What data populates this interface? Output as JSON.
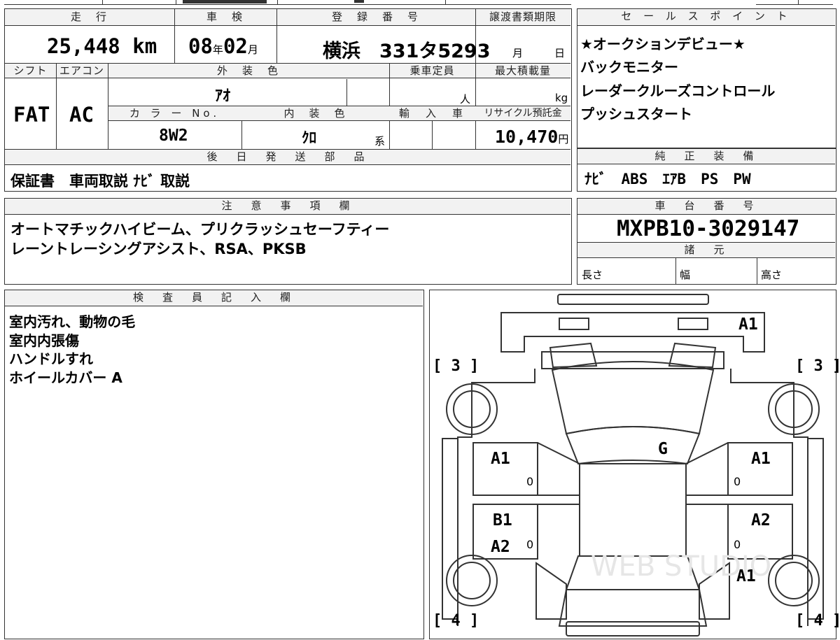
{
  "vehicle": {
    "mileage_header": "走　行",
    "mileage_value": "25,448",
    "mileage_unit": "km",
    "inspection_header": "車　検",
    "inspection_year": "08",
    "inspection_year_unit": "年",
    "inspection_month": "02",
    "inspection_month_unit": "月",
    "registration_header": "登　録　番　号",
    "registration_value": "横浜　331タ5293",
    "transfer_header": "譲渡書類期限",
    "transfer_month_unit": "月",
    "transfer_day_unit": "日",
    "shift_header": "シフト",
    "shift_value": "FAT",
    "ac_header": "エアコン",
    "ac_value": "AC",
    "exterior_color_header": "外　装　色",
    "exterior_color_value": "ｱｵ",
    "capacity_header": "乗車定員",
    "capacity_unit": "人",
    "max_load_header": "最大積載量",
    "max_load_unit": "kg",
    "color_no_header": "カ ラ ー No.",
    "color_no_value": "8W2",
    "interior_color_header": "内　装　色",
    "interior_color_value": "ｸﾛ",
    "interior_color_suffix": "系",
    "import_header": "輸　入　車",
    "recycle_header": "リサイクル預託金",
    "recycle_value": "10,470",
    "recycle_unit": "円",
    "later_parts_header": "後　日　発　送　部　品",
    "later_parts_value": "保証書　車両取説 ﾅﾋﾞ 取説"
  },
  "sales_points": {
    "header": "セ ー ル ス ポ イ ン ト",
    "items": [
      "★オークションデビュー★",
      "バックモニター",
      "レーダークルーズコントロール",
      "プッシュスタート"
    ]
  },
  "genuine_equipment": {
    "header": "純　正　装　備",
    "value": "ﾅﾋﾞ　ABS　ｴｱB　PS　PW"
  },
  "notes": {
    "header": "注　意　事　項　欄",
    "lines": [
      "オートマチックハイビーム、プリクラッシュセーフティー",
      "レーントレーシングアシスト、RSA、PKSB"
    ]
  },
  "chassis": {
    "header": "車　台　番　号",
    "value": "MXPB10-3029147",
    "specs_header": "諸　元",
    "length_label": "長さ",
    "width_label": "幅",
    "height_label": "高さ"
  },
  "inspector": {
    "header": "検　査　員　記　入　欄",
    "lines": [
      "室内汚れ、動物の毛",
      "室内内張傷",
      "ハンドルすれ",
      "ホイールカバー A"
    ]
  },
  "diagram": {
    "marks": {
      "front_bumper": "A1",
      "left_front_tire": "[ 3 ]",
      "right_front_tire": "[ 3 ]",
      "left_rear_tire": "[ 4 ]",
      "right_rear_tire": "[ 4 ]",
      "windshield": "G",
      "left_front_door": "A1",
      "right_front_door": "A1",
      "left_rear_door_1": "B1",
      "left_rear_door_2": "A2",
      "right_rear_door": "A2",
      "right_rear_quarter": "A1",
      "zero_mark": "0"
    },
    "watermark": "WEB STUDIO"
  }
}
